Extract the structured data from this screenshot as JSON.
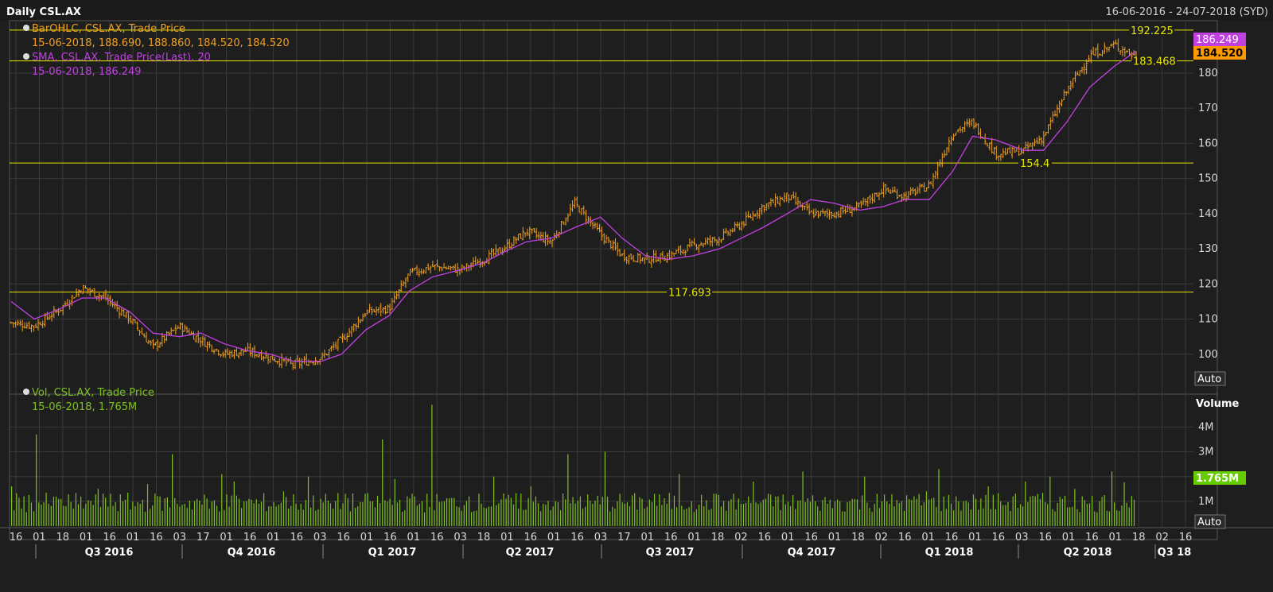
{
  "header": {
    "title": "Daily CSL.AX",
    "date_range": "16-06-2016 - 24-07-2018 (SYD)"
  },
  "colors": {
    "background": "#1e1e1e",
    "grid": "#3a3a3a",
    "bar": "#f0a020",
    "sma": "#c040e0",
    "volume": "#7ec020",
    "hline": "#e6e600",
    "text": "#d8d8d8",
    "last_price_tag": "#ff9900",
    "sma_tag": "#c040e0",
    "volume_tag": "#66cc00"
  },
  "legend": {
    "price_series": "BarOHLC, CSL.AX, Trade Price",
    "price_values": "15-06-2018, 188.690, 188.860, 184.520, 184.520",
    "sma_series": "SMA, CSL.AX, Trade Price(Last),  20",
    "sma_values": "15-06-2018, 186.249",
    "volume_series": "Vol, CSL.AX, Trade Price",
    "volume_values": "15-06-2018, 1.765M"
  },
  "tags": {
    "sma_last": "186.249",
    "price_last": "184.520",
    "volume_last": "1.765M",
    "auto_price": "Auto",
    "auto_volume": "Auto",
    "volume_axis_title": "Volume"
  },
  "chart_data": [
    {
      "type": "ohlc",
      "series": [
        {
          "name": "BarOHLC, CSL.AX, Trade Price",
          "kind": "ohlc-close-path",
          "x": [
            "2016-06-16",
            "2016-07-01",
            "2016-07-18",
            "2016-08-01",
            "2016-08-16",
            "2016-09-01",
            "2016-09-16",
            "2016-10-03",
            "2016-10-17",
            "2016-11-01",
            "2016-11-16",
            "2016-12-01",
            "2016-12-16",
            "2017-01-03",
            "2017-01-16",
            "2017-02-01",
            "2017-02-16",
            "2017-03-01",
            "2017-03-16",
            "2017-04-03",
            "2017-04-18",
            "2017-05-01",
            "2017-05-16",
            "2017-06-01",
            "2017-06-16",
            "2017-07-03",
            "2017-07-17",
            "2017-08-01",
            "2017-08-16",
            "2017-09-01",
            "2017-09-18",
            "2017-10-02",
            "2017-10-16",
            "2017-11-01",
            "2017-11-16",
            "2017-12-01",
            "2017-12-18",
            "2018-01-02",
            "2018-01-16",
            "2018-02-01",
            "2018-02-16",
            "2018-03-01",
            "2018-03-16",
            "2018-04-03",
            "2018-04-16",
            "2018-05-01",
            "2018-05-16",
            "2018-06-01",
            "2018-06-15"
          ],
          "close": [
            109,
            108,
            113,
            119,
            116,
            110,
            102,
            108,
            104,
            100,
            101,
            99,
            97,
            99,
            104,
            112,
            113,
            123,
            125,
            124,
            127,
            130,
            135,
            132,
            143,
            134,
            128,
            127,
            128,
            131,
            133,
            137,
            142,
            145,
            140,
            140,
            142,
            147,
            145,
            148,
            163,
            166,
            157,
            158,
            162,
            175,
            185,
            188,
            184.52
          ]
        },
        {
          "name": "SMA, CSL.AX, Trade Price(Last),  20",
          "x": [
            "2016-06-16",
            "2016-07-01",
            "2016-07-18",
            "2016-08-01",
            "2016-08-16",
            "2016-09-01",
            "2016-09-16",
            "2016-10-03",
            "2016-10-17",
            "2016-11-01",
            "2016-11-16",
            "2016-12-01",
            "2016-12-16",
            "2017-01-03",
            "2017-01-16",
            "2017-02-01",
            "2017-02-16",
            "2017-03-01",
            "2017-03-16",
            "2017-04-03",
            "2017-04-18",
            "2017-05-01",
            "2017-05-16",
            "2017-06-01",
            "2017-06-16",
            "2017-07-03",
            "2017-07-17",
            "2017-08-01",
            "2017-08-16",
            "2017-09-01",
            "2017-09-18",
            "2017-10-02",
            "2017-10-16",
            "2017-11-01",
            "2017-11-16",
            "2017-12-01",
            "2017-12-18",
            "2018-01-02",
            "2018-01-16",
            "2018-02-01",
            "2018-02-16",
            "2018-03-01",
            "2018-03-16",
            "2018-04-03",
            "2018-04-16",
            "2018-05-01",
            "2018-05-16",
            "2018-06-01",
            "2018-06-15"
          ],
          "values": [
            115,
            110,
            113,
            116,
            116,
            112,
            106,
            105,
            106,
            103,
            101,
            100,
            98,
            98,
            100,
            107,
            111,
            118,
            122,
            124,
            126,
            129,
            132,
            133,
            136,
            139,
            133,
            128,
            127,
            128,
            130,
            133,
            136,
            140,
            144,
            143,
            141,
            142,
            144,
            144,
            152,
            162,
            161,
            158,
            158,
            166,
            176,
            182,
            186.249
          ]
        }
      ],
      "horizontal_lines": [
        {
          "value": 192.225,
          "label": "192.225"
        },
        {
          "value": 183.468,
          "label": "183.468"
        },
        {
          "value": 154.4,
          "label": "154.4"
        },
        {
          "value": 117.693,
          "label": "117.693"
        }
      ],
      "y_ticks": [
        "100",
        "110",
        "120",
        "130",
        "140",
        "150",
        "160",
        "170",
        "180"
      ],
      "ylim": [
        90,
        194
      ]
    },
    {
      "type": "bar",
      "series": [
        {
          "name": "Vol, CSL.AX, Trade Price",
          "unit": "M",
          "values": [
            1.6,
            1.2,
            3.7,
            0.9,
            1.1,
            0.7,
            0.9,
            1.5,
            1.3,
            1.0,
            0.8,
            1.7,
            1.2,
            2.9,
            0.9,
            1.1,
            0.7,
            2.1,
            1.8,
            1.0,
            0.9,
            0.8,
            1.4,
            0.9,
            2.0,
            1.1,
            0.7,
            1.3,
            0.8,
            1.0,
            3.5,
            1.9,
            1.2,
            0.9,
            4.9,
            1.0,
            0.8,
            1.2,
            0.9,
            2.0,
            1.1,
            0.7,
            1.6,
            0.9,
            1.0,
            2.9,
            1.2,
            0.9,
            3.0,
            1.0,
            0.8,
            1.1,
            1.3,
            0.9,
            2.1,
            1.0,
            0.8,
            1.3,
            1.0,
            0.9,
            1.8,
            1.1,
            1.2,
            0.8,
            2.2,
            1.0,
            0.9,
            1.0,
            1.1,
            2.0,
            1.3,
            0.9,
            1.0,
            1.2,
            1.4,
            2.3,
            0.9,
            1.0,
            1.1,
            1.6,
            1.0,
            1.2,
            1.8,
            1.3,
            2.0,
            1.1,
            1.5,
            0.9,
            1.0,
            2.2,
            1.765
          ]
        }
      ],
      "y_ticks": [
        "1M",
        "2M",
        "3M",
        "4M"
      ],
      "ylim": [
        0,
        5.2
      ]
    }
  ],
  "x_axis": {
    "day_labels": [
      "16",
      "01",
      "18",
      "01",
      "16",
      "01",
      "16",
      "03",
      "17",
      "01",
      "16",
      "01",
      "16",
      "03",
      "16",
      "01",
      "16",
      "01",
      "16",
      "03",
      "18",
      "01",
      "16",
      "01",
      "16",
      "03",
      "17",
      "01",
      "16",
      "01",
      "18",
      "02",
      "16",
      "01",
      "16",
      "01",
      "18",
      "02",
      "16",
      "01",
      "16",
      "01",
      "16",
      "03",
      "16",
      "01",
      "16",
      "01",
      "18",
      "02",
      "16"
    ],
    "quarters": [
      "Q3 2016",
      "Q4 2016",
      "Q1 2017",
      "Q2 2017",
      "Q3 2017",
      "Q4 2017",
      "Q1 2018",
      "Q2 2018",
      "Q3 18"
    ]
  }
}
